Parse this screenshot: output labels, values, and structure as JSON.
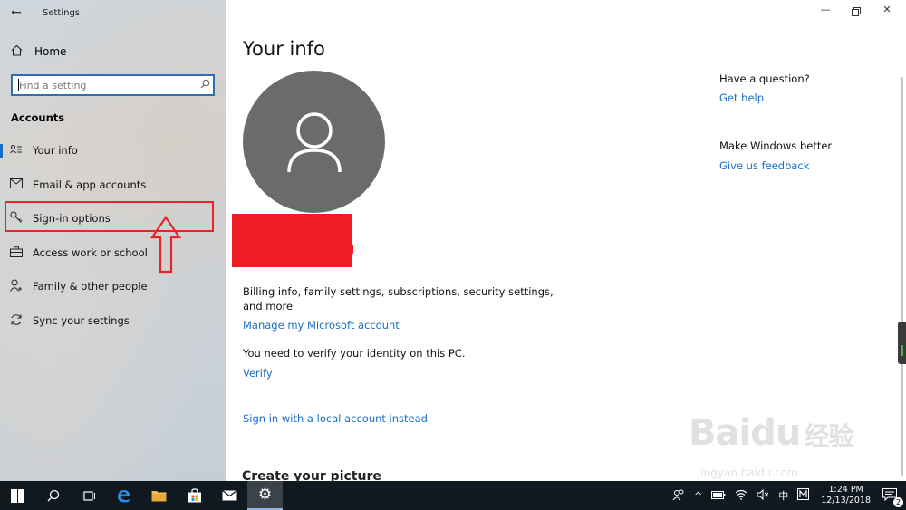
{
  "window": {
    "title": "Settings"
  },
  "sidebar": {
    "home_label": "Home",
    "search_placeholder": "Find a setting",
    "section_heading": "Accounts",
    "items": [
      {
        "label": "Your info",
        "icon": "contact-card-icon"
      },
      {
        "label": "Email & app accounts",
        "icon": "mail-icon"
      },
      {
        "label": "Sign-in options",
        "icon": "key-icon"
      },
      {
        "label": "Access work or school",
        "icon": "briefcase-icon"
      },
      {
        "label": "Family & other people",
        "icon": "person-add-icon"
      },
      {
        "label": "Sync your settings",
        "icon": "sync-icon"
      }
    ]
  },
  "main": {
    "title": "Your info",
    "description": "Billing info, family settings, subscriptions, security settings, and more",
    "manage_link": "Manage my Microsoft account",
    "verify_text": "You need to verify your identity on this PC.",
    "verify_link": "Verify",
    "local_account_link": "Sign in with a local account instead",
    "create_picture_heading": "Create your picture"
  },
  "help": {
    "question_heading": "Have a question?",
    "get_help_link": "Get help",
    "improve_heading": "Make Windows better",
    "feedback_link": "Give us feedback"
  },
  "taskbar": {
    "ime": "中",
    "clock_time": "1:24 PM",
    "clock_date": "12/13/2018",
    "notification_count": "2"
  },
  "watermark": {
    "text": "Bai",
    "text2": "du",
    "cn": "经验",
    "url": "jingyan.baidu.com"
  },
  "colors": {
    "accent": "#1a6fc2",
    "highlight_red": "#e8242b",
    "avatar_gray": "#6b6b6b",
    "taskbar": "#101820"
  }
}
